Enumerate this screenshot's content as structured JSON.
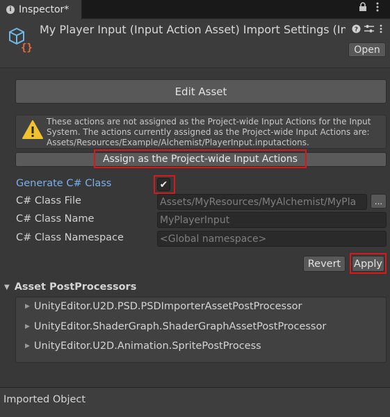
{
  "tab": {
    "icon": "info-icon",
    "label": "Inspector*"
  },
  "tab_controls": {
    "lock_icon": "lock-icon",
    "menu_icon": "kebab-menu-icon"
  },
  "header": {
    "asset_icon": "input-action-asset-icon",
    "title": "My Player Input (Input Action Asset) Import Settings (Input",
    "help_icon": "help-icon",
    "settings_icon": "preset-settings-icon",
    "menu_icon": "kebab-menu-icon",
    "open_label": "Open"
  },
  "edit_asset_label": "Edit Asset",
  "helpbox": {
    "icon": "warning-icon",
    "text": "These actions are not assigned as the Project-wide Input Actions for the Input System.  The actions currently assigned as the Project-wide Input Actions are: Assets/Resources/Example/Alchemist/PlayerInput.inputactions."
  },
  "assign_label": "Assign as the Project-wide Input Actions",
  "generate": {
    "label": "Generate C# Class",
    "checked": true,
    "check_glyph": "✔"
  },
  "fields": {
    "class_file": {
      "label": "C# Class File",
      "value": "Assets/MyResources/MyAlchemist/MyPla"
    },
    "browse_label": "...",
    "class_name": {
      "label": "C# Class Name",
      "value": "MyPlayerInput"
    },
    "namespace": {
      "label": "C# Class Namespace",
      "placeholder": "<Global namespace>"
    }
  },
  "revert_label": "Revert",
  "apply_label": "Apply",
  "postprocessors": {
    "title": "Asset PostProcessors",
    "items": [
      "UnityEditor.U2D.PSD.PSDImporterAssetPostProcessor",
      "UnityEditor.ShaderGraph.ShaderGraphAssetPostProcessor",
      "UnityEditor.U2D.Animation.SpritePostProcess"
    ]
  },
  "footer_label": "Imported Object",
  "colors": {
    "highlight_red": "#d8191c",
    "link_blue": "#7ab0ec",
    "warning_yellow": "#f2c12e"
  }
}
